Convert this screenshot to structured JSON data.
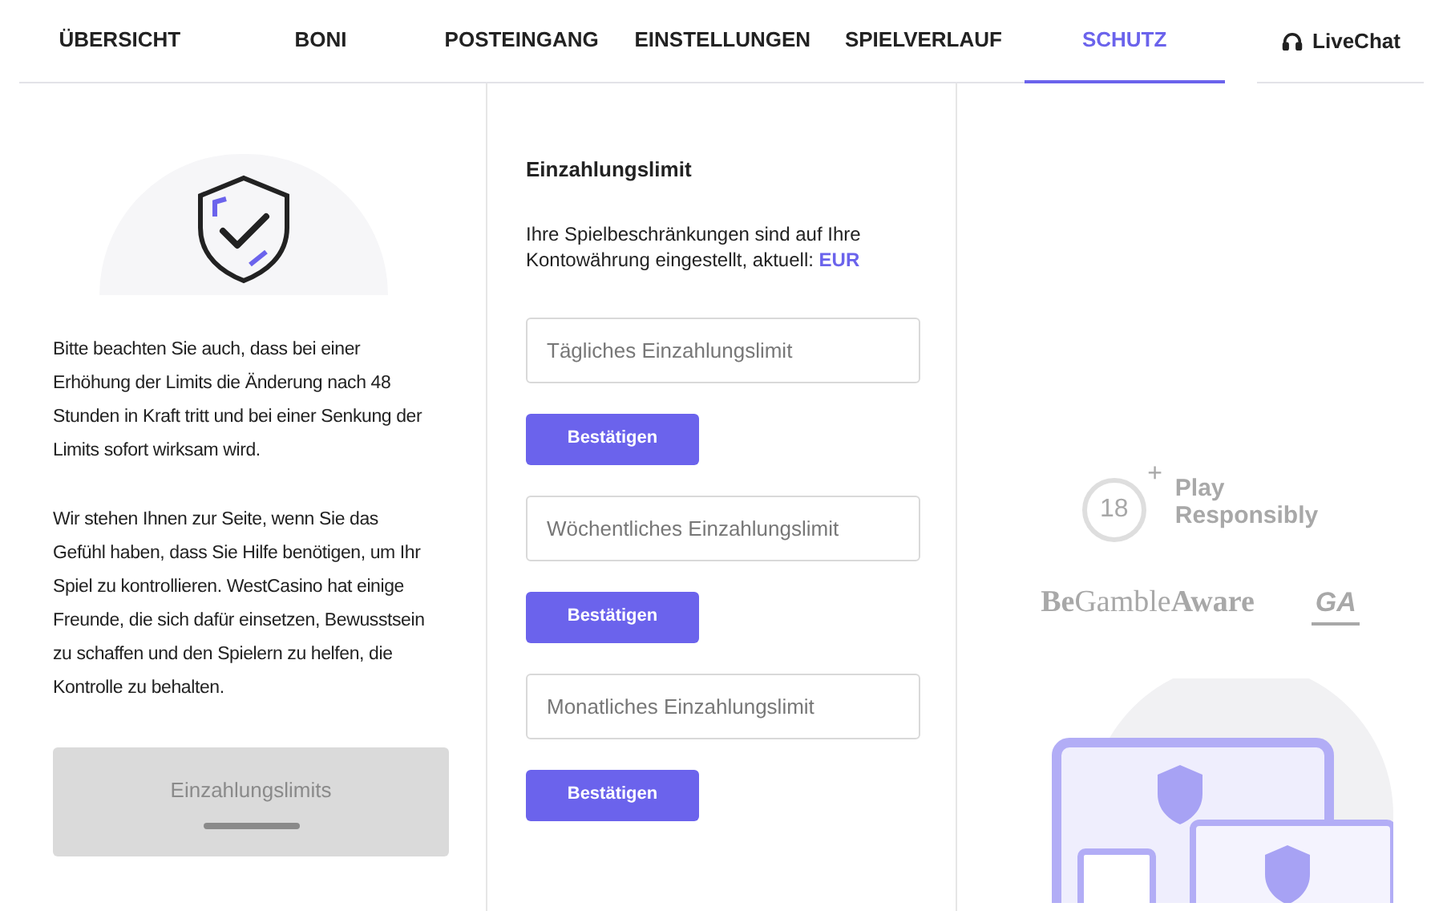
{
  "tabs": [
    {
      "label": "ÜBERSICHT",
      "selected": false
    },
    {
      "label": "BONI",
      "selected": false
    },
    {
      "label": "POSTEINGANG",
      "selected": false
    },
    {
      "label": "EINSTELLUNGEN",
      "selected": false
    },
    {
      "label": "SPIELVERLAUF",
      "selected": false
    },
    {
      "label": "SCHUTZ",
      "selected": true
    }
  ],
  "livechat": {
    "label": "LiveChat"
  },
  "info": {
    "paragraphs": [
      "Bitte beachten Sie auch, dass bei einer Erhöhung der Limits die Änderung nach 48 Stunden in Kraft tritt und bei einer Senkung der Limits sofort wirksam wird.",
      "Wir stehen Ihnen zur Seite, wenn Sie das Gefühl haben, dass Sie Hilfe benötigen, um Ihr Spiel zu kontrollieren. WestCasino hat einige Freunde, die sich dafür einsetzen, Bewusstsein zu schaffen und den Spielern zu helfen, die Kontrolle zu behalten."
    ],
    "section_button": {
      "label": "Einzahlungslimits",
      "selected": true
    }
  },
  "deposit_limit": {
    "title": "Einzahlungslimit",
    "note": "Ihre Spielbeschränkungen sind auf Ihre Kontowährung eingestellt, aktuell:",
    "currency": "EUR",
    "fields": [
      {
        "placeholder": "Tägliches Einzahlungslimit",
        "button": "Bestätigen"
      },
      {
        "placeholder": "Wöchentliches Einzahlungslimit",
        "button": "Bestätigen"
      },
      {
        "placeholder": "Monatliches Einzahlungslimit",
        "button": "Bestätigen"
      }
    ]
  },
  "logos": {
    "age": "18",
    "plus": "+",
    "play_responsibly": [
      "Play",
      "Responsibly"
    ],
    "begambleaware": "**Be**Gamble**Aware**",
    "ga": "GA"
  }
}
